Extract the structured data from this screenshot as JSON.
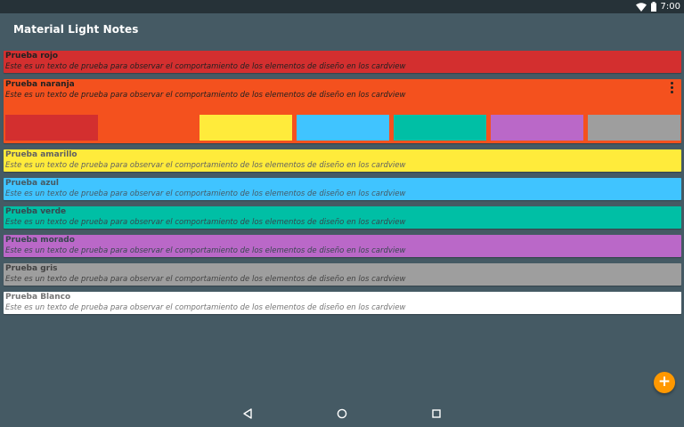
{
  "status_bar": {
    "time": "7:00",
    "wifi_icon": "wifi-icon",
    "battery_icon": "battery-icon"
  },
  "app_bar": {
    "title": "Material Light Notes"
  },
  "notes": [
    {
      "title": "Prueba rojo",
      "text": "Este es un texto de prueba para observar el comportamiento de los elementos de diseño en los cardview",
      "color": "#d32f2f",
      "text_color": "#212121"
    },
    {
      "title": "Prueba naranja",
      "text": "Este es un texto de prueba para observar el comportamiento de los elementos de diseño en los cardview",
      "color": "#f4511e",
      "text_color": "#212121"
    },
    {
      "title": "Prueba amarillo",
      "text": "Este es un texto de prueba para observar el comportamiento de los elementos de diseño en los cardview",
      "color": "#ffeb3b",
      "text_color": "#616161"
    },
    {
      "title": "Prueba azul",
      "text": "Este es un texto de prueba para observar el comportamiento de los elementos de diseño en los cardview",
      "color": "#40c4ff",
      "text_color": "#455a64"
    },
    {
      "title": "Prueba verde",
      "text": "Este es un texto de prueba para observar el comportamiento de los elementos de diseño en los cardview",
      "color": "#00bfa5",
      "text_color": "#37474f"
    },
    {
      "title": "Prueba morado",
      "text": "Este es un texto de prueba para observar el comportamiento de los elementos de diseño en los cardview",
      "color": "#ba68c8",
      "text_color": "#37474f"
    },
    {
      "title": "Prueba gris",
      "text": "Este es un texto de prueba para observar el comportamiento de los elementos de diseño en los cardview",
      "color": "#9e9e9e",
      "text_color": "#424242"
    },
    {
      "title": "Prueba Blanco",
      "text": "Este es un texto de prueba para observar el comportamiento de los elementos de diseño en los cardview",
      "color": "#ffffff",
      "text_color": "#757575"
    }
  ],
  "expanded_note": {
    "index": 1,
    "menu_icon": "more-vert-icon",
    "swatch_colors": [
      "#d32f2f",
      "#f4511e",
      "#ffeb3b",
      "#40c4ff",
      "#00bfa5",
      "#ba68c8",
      "#9e9e9e"
    ]
  },
  "fab": {
    "icon": "add-icon",
    "glyph": "+",
    "color": "#ff9800"
  },
  "nav_bar": {
    "back_icon": "back-icon",
    "home_icon": "home-icon",
    "recents_icon": "recents-icon"
  }
}
